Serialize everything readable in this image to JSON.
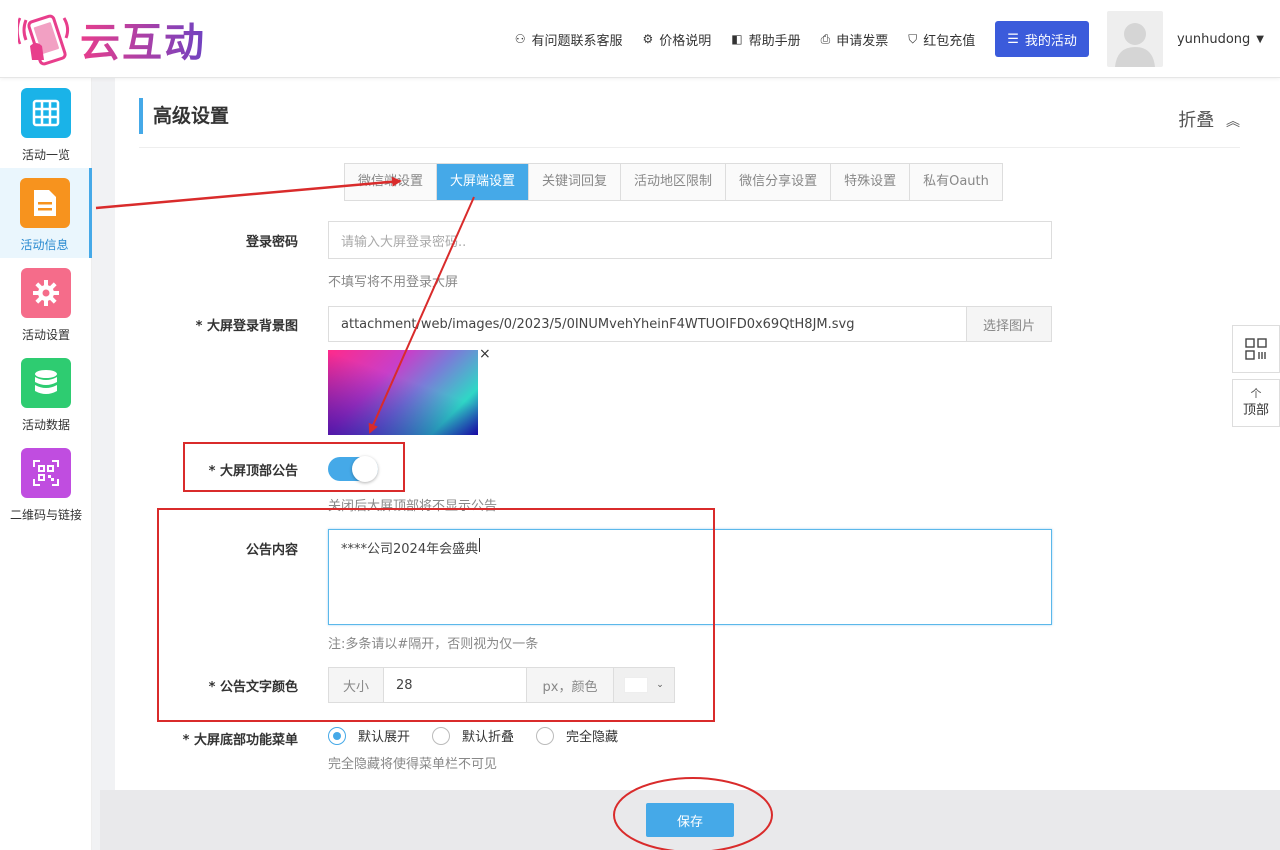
{
  "header": {
    "logo_text": "云互动",
    "nav": [
      {
        "icon": "user-plus-icon",
        "glyph": "⚇",
        "label": "有问题联系客服"
      },
      {
        "icon": "gear-icon",
        "glyph": "⚙",
        "label": "价格说明"
      },
      {
        "icon": "book-icon",
        "glyph": "◧",
        "label": "帮助手册"
      },
      {
        "icon": "printer-icon",
        "glyph": "⎙",
        "label": "申请发票"
      },
      {
        "icon": "shield-check-icon",
        "glyph": "⛉",
        "label": "红包充值"
      }
    ],
    "my_activity": "我的活动",
    "username": "yunhudong"
  },
  "sidebar": {
    "items": [
      {
        "label": "活动一览",
        "color": "#1ab3e8",
        "icon": "grid-icon"
      },
      {
        "label": "活动信息",
        "color": "#f7931e",
        "icon": "document-icon"
      },
      {
        "label": "活动设置",
        "color": "#f56c8a",
        "icon": "gear-icon"
      },
      {
        "label": "活动数据",
        "color": "#2ecc71",
        "icon": "database-icon"
      },
      {
        "label": "二维码与链接",
        "color": "#c04de0",
        "icon": "qrcode-icon"
      }
    ]
  },
  "section": {
    "title": "高级设置",
    "fold_label": "折叠"
  },
  "tabs": [
    "微信端设置",
    "大屏端设置",
    "关键词回复",
    "活动地区限制",
    "微信分享设置",
    "特殊设置",
    "私有Oauth"
  ],
  "form": {
    "login_password": {
      "label": "登录密码",
      "placeholder": "请输入大屏登录密码..",
      "help": "不填写将不用登录大屏"
    },
    "background": {
      "label": "* 大屏登录背景图",
      "value": "attachment/web/images/0/2023/5/0INUMvehYheinF4WTUOIFD0x69QtH8JM.svg",
      "button": "选择图片",
      "remove": "×"
    },
    "notice_toggle": {
      "label": "* 大屏顶部公告",
      "on": true,
      "help": "关闭后大屏顶部将不显示公告"
    },
    "notice_content": {
      "label": "公告内容",
      "value": "****公司2024年会盛典",
      "help": "注:多条请以#隔开，否则视为仅一条"
    },
    "notice_color": {
      "label": "* 公告文字颜色",
      "size_prefix": "大小",
      "size_value": "28",
      "size_suffix": "px，颜色",
      "color": "#ffffff"
    },
    "bottom_menu": {
      "label": "* 大屏底部功能菜单",
      "options": [
        "默认展开",
        "默认折叠",
        "完全隐藏"
      ],
      "selected": 0,
      "help": "完全隐藏将使得菜单栏不可见"
    }
  },
  "save_button": "保存",
  "float_tools": {
    "top_label": "顶部",
    "up_glyph": "个"
  },
  "annotation_color": "#d92b2b"
}
